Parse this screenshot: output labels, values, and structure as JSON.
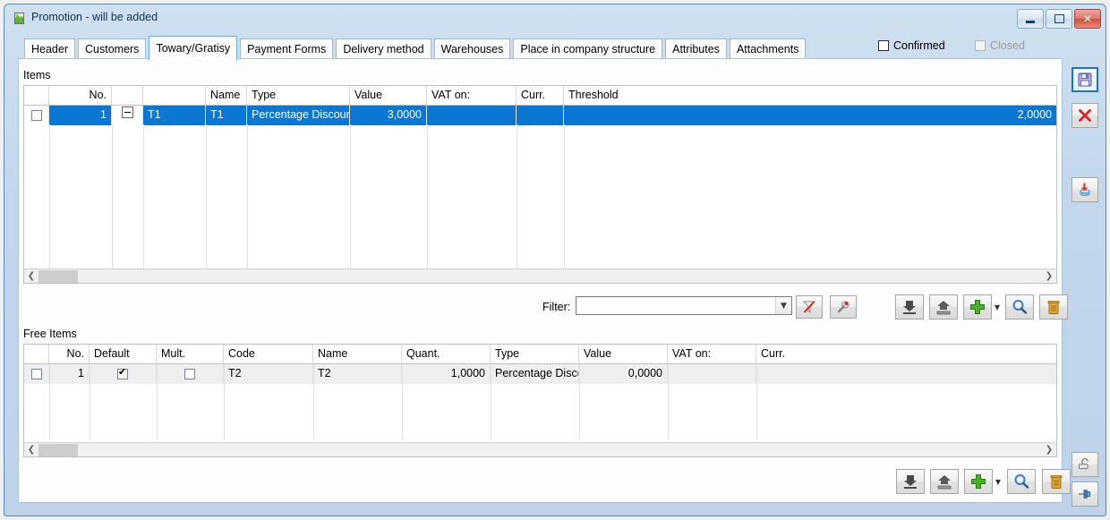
{
  "window": {
    "title": "Promotion - will be added",
    "icon": "app-window-icon",
    "minimize_label": "Minimize",
    "maximize_label": "Maximize",
    "close_label": "Close"
  },
  "tabs": [
    {
      "label": "Header",
      "active": false
    },
    {
      "label": "Customers",
      "active": false
    },
    {
      "label": "Towary/Gratisy",
      "active": true
    },
    {
      "label": "Payment Forms",
      "active": false
    },
    {
      "label": "Delivery method",
      "active": false
    },
    {
      "label": "Warehouses",
      "active": false
    },
    {
      "label": "Place in company structure",
      "active": false
    },
    {
      "label": "Attributes",
      "active": false
    },
    {
      "label": "Attachments",
      "active": false
    }
  ],
  "status_checkboxes": {
    "confirmed": {
      "label": "Confirmed",
      "checked": false,
      "disabled": false
    },
    "closed": {
      "label": "Closed",
      "checked": false,
      "disabled": true
    }
  },
  "items_panel": {
    "group_label": "Items",
    "columns": [
      {
        "key": "check",
        "label": "",
        "align": "center"
      },
      {
        "key": "no",
        "label": "No.",
        "align": "right"
      },
      {
        "key": "expand",
        "label": "",
        "align": "center"
      },
      {
        "key": "code",
        "label": "",
        "align": "left"
      },
      {
        "key": "name",
        "label": "Name",
        "align": "left"
      },
      {
        "key": "type",
        "label": "Type",
        "align": "left"
      },
      {
        "key": "value",
        "label": "Value",
        "align": "right"
      },
      {
        "key": "vat_on",
        "label": "VAT on:",
        "align": "right"
      },
      {
        "key": "curr",
        "label": "Curr.",
        "align": "right"
      },
      {
        "key": "threshold",
        "label": "Threshold",
        "align": "right"
      }
    ],
    "rows": [
      {
        "selected": true,
        "check": false,
        "no": "1",
        "expand": "collapse-toggle",
        "code": "T1",
        "name": "T1",
        "type": "Percentage Discount",
        "value": "3,0000",
        "vat_on": "",
        "curr": "",
        "threshold": "2,0000"
      }
    ]
  },
  "filter_bar": {
    "label": "Filter:",
    "value": "",
    "placeholder": "",
    "dropdown_icon": "chevron-down-icon",
    "clear_filter_icon": "clear-filter-icon",
    "edit_filter_icon": "filter-settings-icon",
    "buttons": [
      {
        "name": "import-from-file-button",
        "icon": "arrow-down-into-tray-icon"
      },
      {
        "name": "export-to-file-button",
        "icon": "arrow-up-out-of-tray-icon"
      },
      {
        "name": "add-item-button",
        "icon": "plus-icon"
      },
      {
        "name": "add-item-dropdown",
        "icon": "chevron-down-small-icon"
      },
      {
        "name": "preview-item-button",
        "icon": "magnifier-icon"
      },
      {
        "name": "delete-item-button",
        "icon": "trash-icon"
      }
    ]
  },
  "free_items_panel": {
    "group_label": "Free Items",
    "columns": [
      {
        "key": "check",
        "label": "",
        "align": "center"
      },
      {
        "key": "no",
        "label": "No.",
        "align": "right"
      },
      {
        "key": "default",
        "label": "Default",
        "align": "center"
      },
      {
        "key": "mult",
        "label": "Mult.",
        "align": "center"
      },
      {
        "key": "code",
        "label": "Code",
        "align": "left"
      },
      {
        "key": "name",
        "label": "Name",
        "align": "left"
      },
      {
        "key": "quant",
        "label": "Quant.",
        "align": "right"
      },
      {
        "key": "type",
        "label": "Type",
        "align": "left"
      },
      {
        "key": "value",
        "label": "Value",
        "align": "right"
      },
      {
        "key": "vat_on",
        "label": "VAT on:",
        "align": "left"
      },
      {
        "key": "curr",
        "label": "Curr.",
        "align": "left"
      }
    ],
    "rows": [
      {
        "selected": false,
        "check": false,
        "no": "1",
        "default": true,
        "mult": false,
        "code": "T2",
        "name": "T2",
        "quant": "1,0000",
        "type": "Percentage Disco",
        "value": "0,0000",
        "vat_on": "",
        "curr": ""
      }
    ],
    "buttons": [
      {
        "name": "import-from-file-button",
        "icon": "arrow-down-into-tray-icon"
      },
      {
        "name": "export-to-file-button",
        "icon": "arrow-up-out-of-tray-icon"
      },
      {
        "name": "add-free-item-button",
        "icon": "plus-icon"
      },
      {
        "name": "add-free-item-dropdown",
        "icon": "chevron-down-small-icon"
      },
      {
        "name": "preview-free-item-button",
        "icon": "magnifier-icon"
      },
      {
        "name": "delete-free-item-button",
        "icon": "trash-icon"
      }
    ]
  },
  "right_toolbar": {
    "buttons": [
      {
        "name": "save-button",
        "icon": "floppy-disk-icon",
        "selected": true
      },
      {
        "name": "cancel-button",
        "icon": "red-x-icon",
        "selected": false
      },
      {
        "name": "import-to-database-button",
        "icon": "database-import-icon",
        "selected": false
      },
      {
        "name": "unlock-button",
        "icon": "open-padlock-icon",
        "selected": false
      },
      {
        "name": "pin-window-button",
        "icon": "pin-icon",
        "selected": false
      }
    ]
  },
  "colors": {
    "selection_blue": "#0a78d2",
    "title_gradient_top": "#cfe0f0",
    "alt_row": "#efefef",
    "accent_border": "#5b8bbd"
  }
}
